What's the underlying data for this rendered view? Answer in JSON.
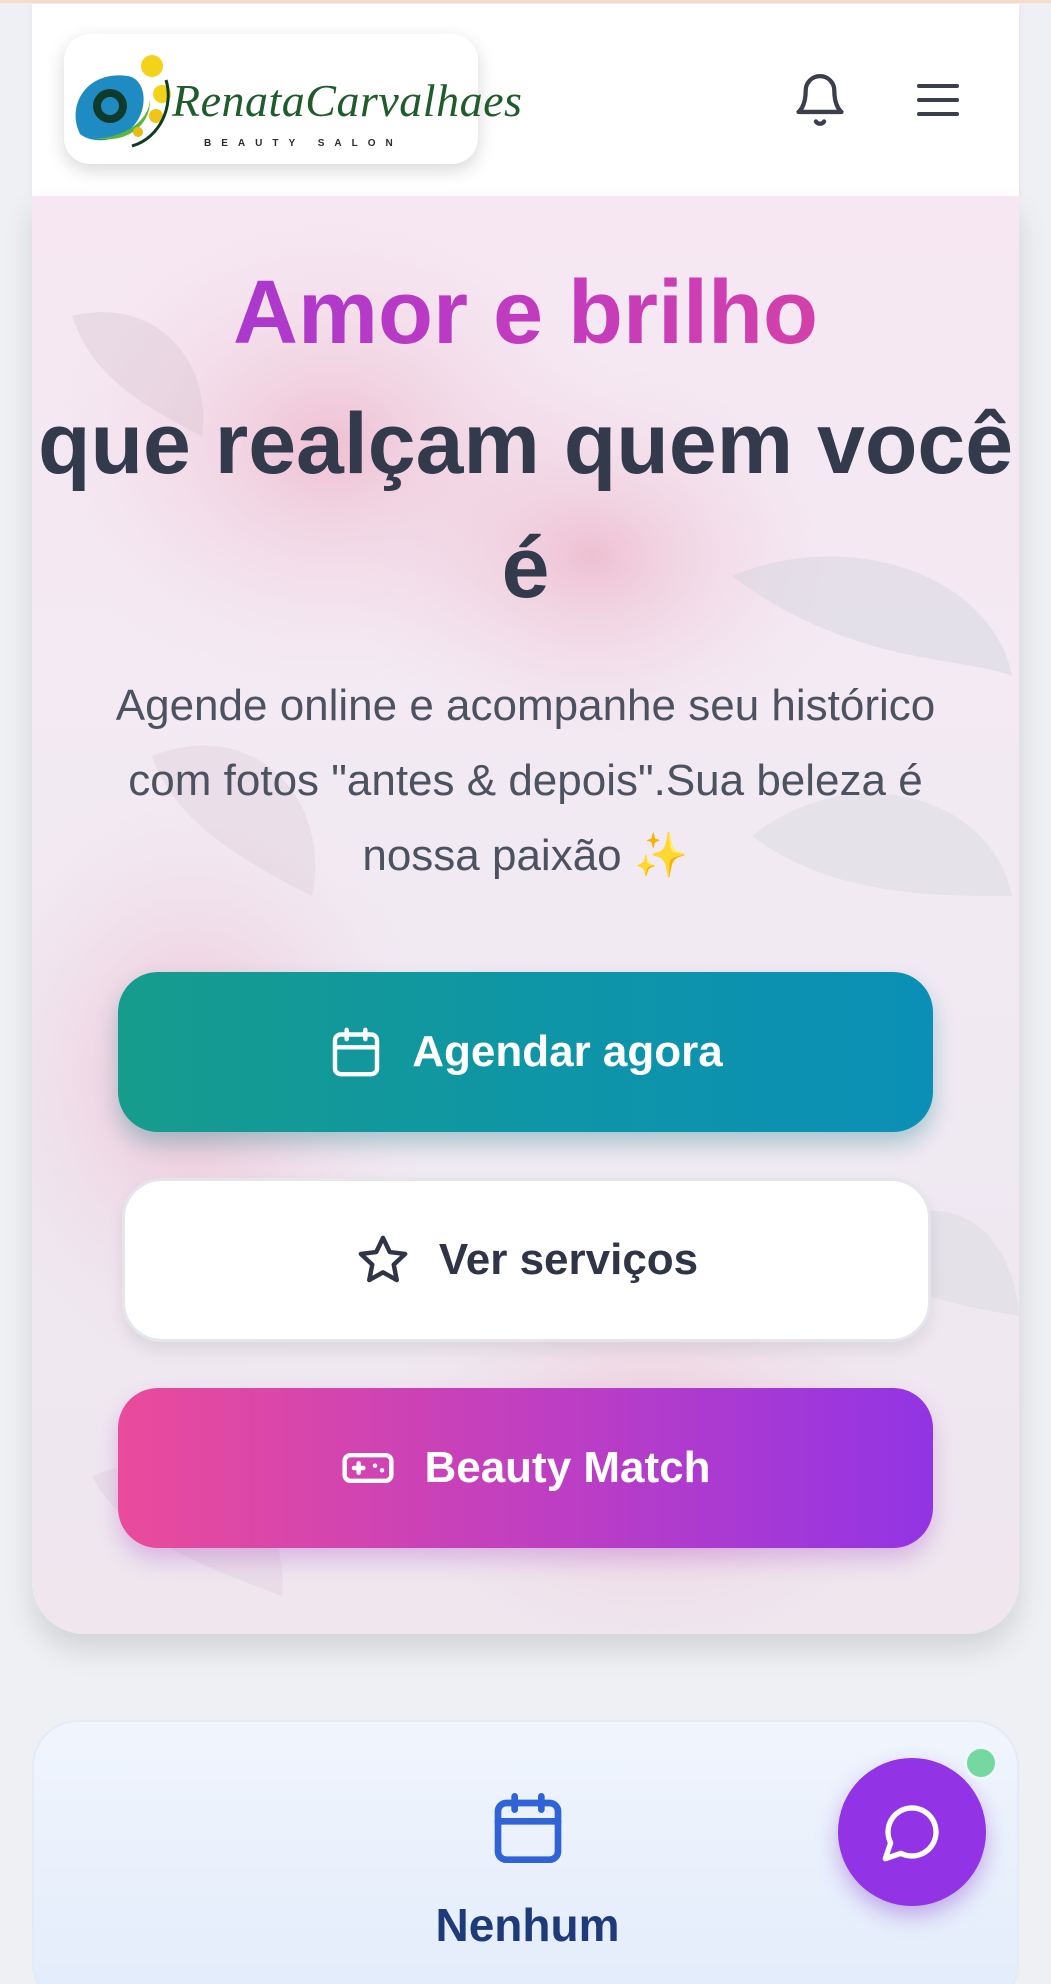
{
  "header": {
    "logo_text": "RenataCarvalhaes",
    "logo_subtext": "BEAUTY SALON",
    "bell_icon": "bell-icon",
    "menu_icon": "hamburger-menu-icon"
  },
  "hero": {
    "title_highlight": "Amor e brilho",
    "title_rest": "que realçam quem você é",
    "subtitle": "Agende online e acompanhe seu histórico com fotos \"antes & depois\".Sua beleza é nossa paixão ✨",
    "buttons": {
      "schedule": {
        "label": "Agendar agora",
        "icon": "calendar-icon"
      },
      "services": {
        "label": "Ver serviços",
        "icon": "star-icon"
      },
      "match": {
        "label": "Beauty Match",
        "icon": "gamepad-icon"
      }
    }
  },
  "next_appointment": {
    "icon": "calendar-icon",
    "value": "Nenhum"
  },
  "chat": {
    "icon": "chat-bubble-icon",
    "online_color": "#74d9a0"
  },
  "colors": {
    "primary_teal": "#169c8c",
    "accent_purple": "#9233e6",
    "accent_pink": "#ea4b9b",
    "heading_dark": "#333a4c"
  }
}
